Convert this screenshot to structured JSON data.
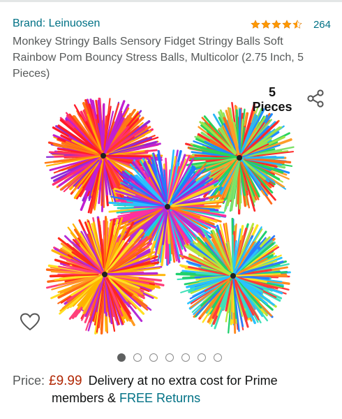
{
  "product": {
    "brand": "Brand: Leinuosen",
    "rating": 4.5,
    "rating_max": 5,
    "review_count": "264",
    "title": "Monkey Stringy Balls Sensory Fidget Stringy Balls Soft Rainbow Pom Bouncy Stress Balls, Multicolor (2.75 Inch, 5 Pieces)"
  },
  "image": {
    "caption_line1": "5",
    "caption_line2": "Pieces",
    "icons": {
      "share": "share-icon",
      "wishlist": "heart-icon"
    }
  },
  "carousel": {
    "total_dots": 7,
    "active_index": 0
  },
  "pricing": {
    "label": "Price:",
    "price": "£9.99",
    "delivery": "Delivery at no extra cost for Prime",
    "delivery_cont": "members &",
    "returns_link": "FREE Returns"
  },
  "colors": {
    "link": "#007185",
    "price": "#b12704",
    "star": "#ff9900",
    "muted_text": "#565959"
  }
}
